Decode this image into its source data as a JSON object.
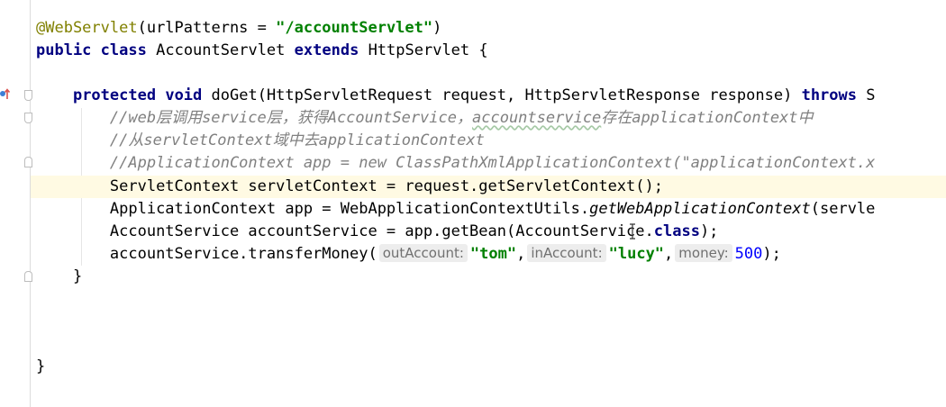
{
  "editor": {
    "lines": {
      "l1": {
        "annotation": "@WebServlet",
        "open": "(urlPatterns = ",
        "url": "\"/accountServlet\"",
        "close": ")"
      },
      "l2": {
        "kw1": "public",
        "kw2": "class",
        "name": "AccountServlet",
        "kw3": "extends",
        "parent": "HttpServlet {"
      },
      "l4": {
        "kw1": "protected",
        "kw2": "void",
        "sig": "doGet(HttpServletRequest request, HttpServletResponse response)",
        "kw3": "throws",
        "tail": "S"
      },
      "l5": {
        "c1": "//web层调用service层，获得AccountService，",
        "c2": "accountservice",
        "c3": "存在applicationContext中"
      },
      "l6": {
        "comment": "//从servletContext域中去applicationContext"
      },
      "l7": {
        "comment": "//ApplicationContext app = new ClassPathXmlApplicationContext(\"applicationContext.x"
      },
      "l8": {
        "code": "ServletContext servletContext = request.getServletContext();"
      },
      "l9": {
        "pre": "ApplicationContext app = WebApplicationContextUtils.",
        "method": "getWebApplicationContext",
        "post": "(servle"
      },
      "l10": {
        "pre": "AccountService accountService = app.getBean(AccountService.",
        "kw": "class",
        "post": ");"
      },
      "l11": {
        "pre": "accountService.transferMoney(",
        "hint1": "outAccount:",
        "arg1": "\"tom\"",
        "sep1": ",",
        "hint2": "inAccount:",
        "arg2": "\"lucy\"",
        "sep2": ",",
        "hint3": "money:",
        "arg3": "500",
        "post": ");"
      },
      "l12": {
        "code": "}"
      },
      "l16": {
        "code": "}"
      }
    }
  }
}
